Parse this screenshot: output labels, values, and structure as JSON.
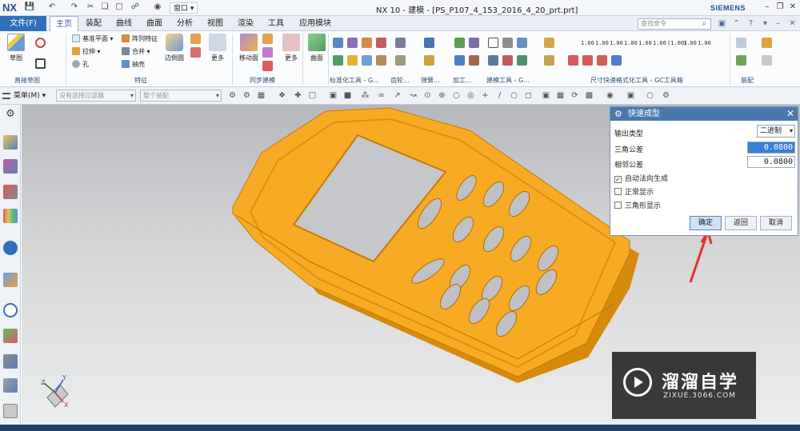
{
  "app": {
    "logo": "NX",
    "window_title": "NX 10 - 建模 - [PS_P107_4_153_2016_4_20_prt.prt]",
    "brand": "SIEMENS",
    "window_menu": "窗口"
  },
  "tabs": [
    {
      "label": "文件(F)"
    },
    {
      "label": "主页"
    },
    {
      "label": "装配"
    },
    {
      "label": "曲线"
    },
    {
      "label": "曲面"
    },
    {
      "label": "分析"
    },
    {
      "label": "视图"
    },
    {
      "label": "渲染"
    },
    {
      "label": "工具"
    },
    {
      "label": "应用模块"
    }
  ],
  "command_search": {
    "placeholder": "查找命令"
  },
  "ribbon": {
    "sketch_label": "草图",
    "datum_plane": "基准平面",
    "extrude": "拉伸",
    "hole": "孔",
    "pattern_feature": "阵列特征",
    "unite": "合并",
    "shell": "抽壳",
    "edge_blend": "边倒圆",
    "more1": "更多",
    "move_face": "移动面",
    "more2": "更多",
    "surface": "曲面",
    "groups": {
      "direct_sketch": "直接草图",
      "feature": "特征",
      "sync_modeling": "同步建模",
      "standard_tools": "标准化工具 - G...",
      "gear": "齿轮...",
      "spring": "弹簧...",
      "machining": "加工...",
      "modeling_tools": "建模工具 - G...",
      "dim_quick": "尺寸快速格式化工具 - GC工具箱",
      "assembly": "装配"
    },
    "tol_nums": [
      "1.00",
      "1.00",
      "1.00",
      "1.00",
      "1.00",
      "1.00",
      "(1.00)",
      "1.00",
      "1.00"
    ]
  },
  "toolbar2": {
    "menu": "菜单(M)",
    "filter_placeholder": "没有选择过滤器",
    "assembly_placeholder": "整个装配"
  },
  "dialog": {
    "title": "快速成型",
    "output_type_label": "输出类型",
    "output_type_value": "二进制",
    "triangle_tol_label": "三角公差",
    "triangle_tol_value": "0.0800",
    "adjacent_tol_label": "相邻公差",
    "adjacent_tol_value": "0.0800",
    "checkboxes": [
      {
        "label": "自动法向生成",
        "checked": true
      },
      {
        "label": "正常显示",
        "checked": false
      },
      {
        "label": "三角形显示",
        "checked": false
      }
    ],
    "ok": "确定",
    "back": "返回",
    "cancel": "取消"
  },
  "watermark": {
    "cn": "溜溜自学",
    "en": "ZIXUE.3066.COM"
  },
  "triad": {
    "x": "X",
    "y": "Y",
    "z": "Z"
  },
  "colors": {
    "part": "#f5a623",
    "part_dark": "#d98c0f",
    "dialog_header": "#4b79ad",
    "file_tab": "#2f6fb8",
    "arrow": "#e8312a"
  }
}
